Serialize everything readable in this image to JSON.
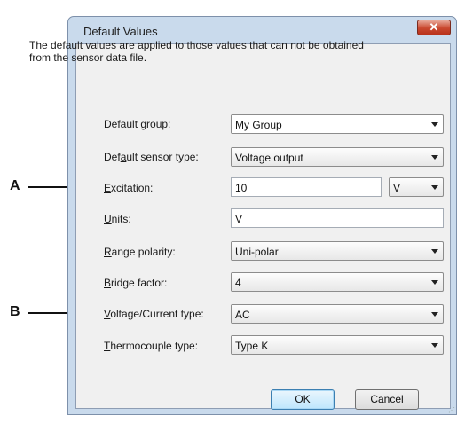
{
  "dialog": {
    "title": "Default Values",
    "close_glyph": "✕",
    "description": "The default values are applied to those values that can not be obtained from the sensor data file."
  },
  "fields": {
    "default_group": {
      "label_mnemonic": "D",
      "label_rest": "efault group:",
      "value": "My Group"
    },
    "default_sensor_type": {
      "label_pre": "Def",
      "label_mnemonic": "a",
      "label_rest": "ult sensor type:",
      "value": "Voltage output"
    },
    "excitation": {
      "label_mnemonic": "E",
      "label_rest": "xcitation:",
      "value": "10",
      "unit": "V"
    },
    "units": {
      "label_mnemonic": "U",
      "label_rest": "nits:",
      "value": "V"
    },
    "range_polarity": {
      "label_mnemonic": "R",
      "label_rest": "ange polarity:",
      "value": "Uni-polar"
    },
    "bridge_factor": {
      "label_mnemonic": "B",
      "label_rest": "ridge factor:",
      "value": "4"
    },
    "voltage_current_type": {
      "label_mnemonic": "V",
      "label_rest": "oltage/Current type:",
      "value": "AC"
    },
    "thermocouple_type": {
      "label_mnemonic": "T",
      "label_rest": "hermocouple type:",
      "value": "Type K"
    }
  },
  "buttons": {
    "ok": "OK",
    "cancel": "Cancel"
  },
  "callouts": {
    "a": "A",
    "b": "B"
  }
}
